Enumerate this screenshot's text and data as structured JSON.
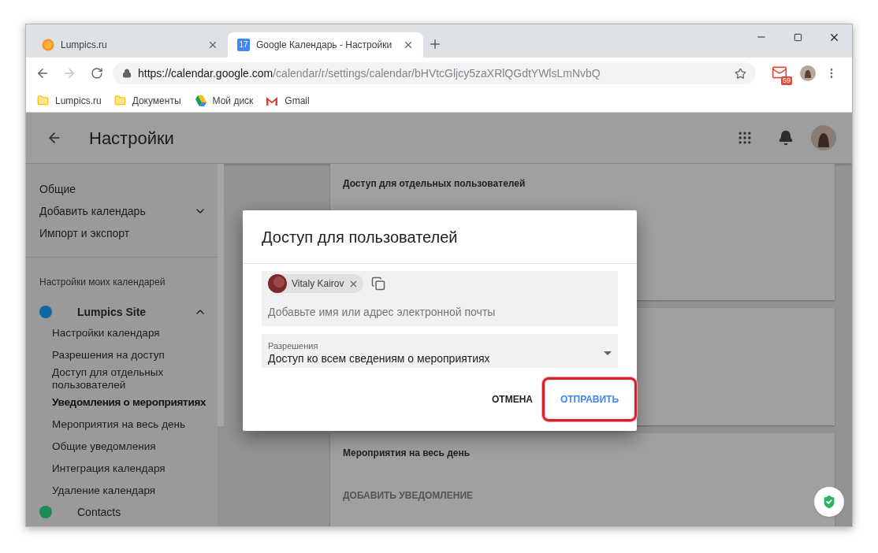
{
  "browser": {
    "tabs": [
      {
        "title": "Lumpics.ru",
        "kind": "site",
        "selected": false
      },
      {
        "title": "Google Календарь - Настройки",
        "kind": "calendar",
        "icon_text": "17",
        "selected": true
      }
    ],
    "url": {
      "host": "https://calendar.google.com",
      "path": "/calendar/r/settings/calendar/bHVtcGljcy5zaXRlQGdtYWlsLmNvbQ"
    },
    "bookmarks": [
      {
        "label": "Lumpics.ru",
        "kind": "folder"
      },
      {
        "label": "Документы",
        "kind": "folder"
      },
      {
        "label": "Мой диск",
        "kind": "drive"
      },
      {
        "label": "Gmail",
        "kind": "gmail"
      }
    ],
    "mail_badge": "59"
  },
  "app": {
    "title": "Настройки",
    "sidebar": {
      "items": [
        {
          "label": "Общие",
          "kind": "link"
        },
        {
          "label": "Добавить календарь",
          "kind": "expandable",
          "expanded": false
        },
        {
          "label": "Импорт и экспорт",
          "kind": "link"
        }
      ],
      "section_heading": "Настройки моих календарей",
      "calendars": [
        {
          "name": "Lumpics Site",
          "color": "#0b6aa6",
          "expanded": true,
          "children": [
            {
              "label": "Настройки календаря",
              "selected": false
            },
            {
              "label": "Разрешения на доступ",
              "selected": false
            },
            {
              "label": "Доступ для отдельных пользователей",
              "selected": false
            },
            {
              "label": "Уведомления о мероприятиях",
              "selected": true
            },
            {
              "label": "Мероприятия на весь день",
              "selected": false
            },
            {
              "label": "Общие уведомления",
              "selected": false
            },
            {
              "label": "Интеграция календаря",
              "selected": false
            },
            {
              "label": "Удаление календаря",
              "selected": false
            }
          ]
        },
        {
          "name": "Contacts",
          "color": "#1e8a55"
        }
      ]
    },
    "cards": [
      {
        "kind": "section",
        "title": "Доступ для отдельных пользователей"
      },
      {
        "kind": "blank"
      },
      {
        "kind": "section",
        "title": "Мероприятия на весь день",
        "action": "ДОБАВИТЬ УВЕДОМЛЕНИЕ"
      }
    ]
  },
  "dialog": {
    "title": "Доступ для пользователей",
    "chips": [
      {
        "name": "Vitaly Kairov"
      }
    ],
    "placeholder": "Добавьте имя или адрес электронной почты",
    "select": {
      "label": "Разрешения",
      "value": "Доступ ко всем сведениям о мероприятиях"
    },
    "buttons": [
      {
        "label": "ОТМЕНА",
        "kind": "plain",
        "highlighted": false
      },
      {
        "label": "ОТПРАВИТЬ",
        "kind": "primary",
        "highlighted": true
      }
    ]
  }
}
